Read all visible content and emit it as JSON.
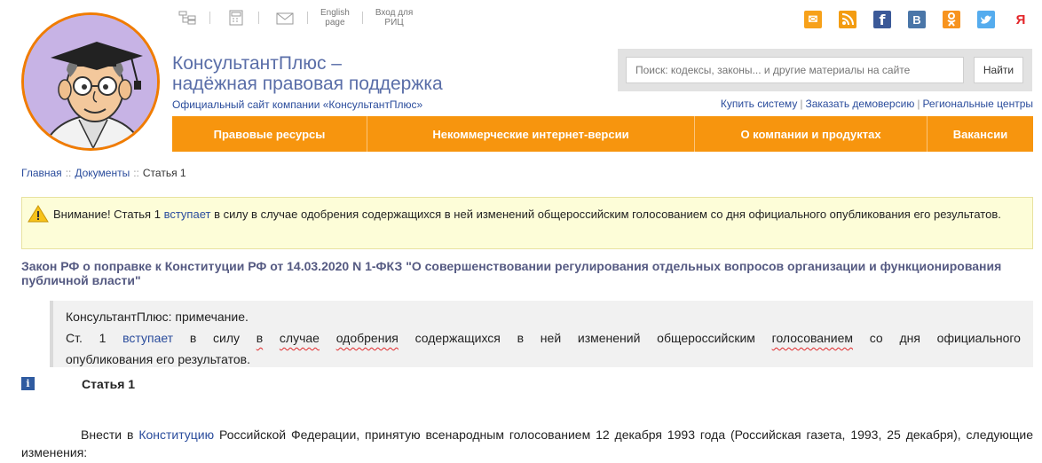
{
  "header": {
    "top_links": {
      "english_line1": "English",
      "english_line2": "page",
      "ric_line1": "Вход для",
      "ric_line2": "РИЦ"
    },
    "brand_line1": "КонсультантПлюс –",
    "brand_line2": "надёжная правовая поддержка",
    "tagline": "Официальный сайт компании «КонсультантПлюс»",
    "search": {
      "placeholder": "Поиск: кодексы, законы... и другие материалы на сайте",
      "button": "Найти"
    },
    "links": [
      "Купить систему",
      "Заказать демоверсию",
      "Региональные центры"
    ],
    "social": [
      {
        "icon": "email-icon",
        "color": "#f7a11a",
        "glyph": "✉"
      },
      {
        "icon": "rss-icon",
        "color": "#f39c12",
        "glyph": "◉"
      },
      {
        "icon": "facebook-icon",
        "color": "#3b5998",
        "glyph": "f"
      },
      {
        "icon": "vk-icon",
        "color": "#4a76a8",
        "glyph": "B"
      },
      {
        "icon": "odnoklassniki-icon",
        "color": "#f7931e",
        "glyph": "ok"
      },
      {
        "icon": "twitter-icon",
        "color": "#55acee",
        "glyph": "t"
      },
      {
        "icon": "yandex-icon",
        "color": "#ffffff",
        "glyph": "Я"
      }
    ]
  },
  "nav": {
    "items": [
      "Правовые ресурсы",
      "Некоммерческие интернет-версии",
      "О компании и продуктах",
      "Вакансии"
    ]
  },
  "breadcrumb": {
    "home": "Главная",
    "docs": "Документы",
    "current": "Статья 1"
  },
  "warning": {
    "prefix": "Внимание! Статья 1",
    "link": "вступает",
    "rest": "в силу в случае одобрения содержащихся в ней изменений общероссийским голосованием со дня официального опубликования его результатов."
  },
  "law_title": "Закон РФ о поправке к Конституции РФ от 14.03.2020 N 1-ФКЗ \"О совершенствовании регулирования отдельных вопросов организации и функционирования публичной власти\"",
  "note": {
    "heading": "КонсультантПлюс: примечание.",
    "words": [
      "Ст.",
      "1",
      "вступает",
      "в",
      "силу",
      "в",
      "случае",
      "одобрения",
      "содержащихся",
      "в",
      "ней",
      "изменений",
      "общероссийским",
      "голосованием",
      "со",
      "дня",
      "официального"
    ],
    "line3": "опубликования его результатов."
  },
  "article": {
    "info_icon": "i",
    "title": "Статья 1",
    "body_prefix": "Внести в",
    "body_link": "Конституцию",
    "body_rest": "Российской Федерации, принятую всенародным голосованием 12 декабря 1993 года (Российская газета, 1993, 25 декабря), следующие изменения:"
  }
}
